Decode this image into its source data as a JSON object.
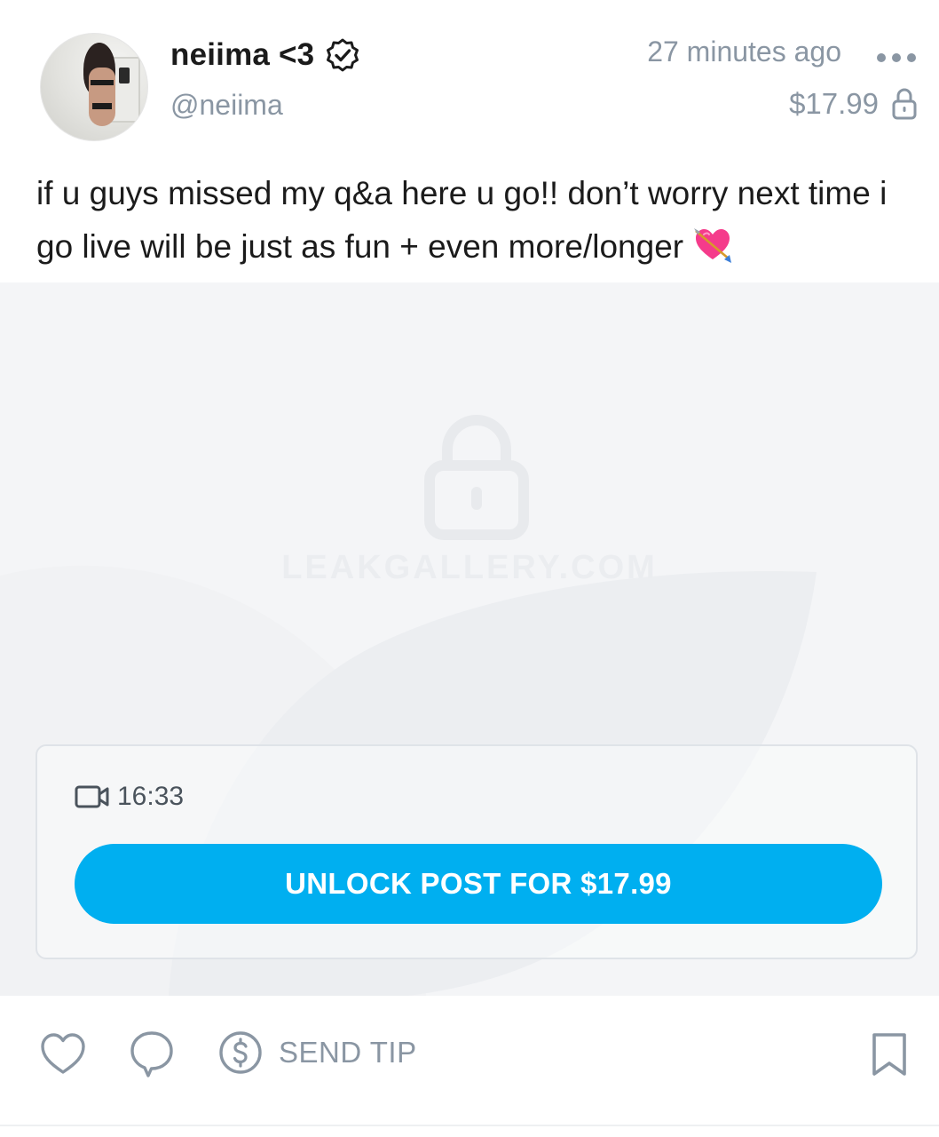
{
  "post": {
    "author": {
      "display_name": "neiima <3",
      "username": "@neiima",
      "verified": true
    },
    "timestamp": "27 minutes ago",
    "price": "$17.99",
    "caption": "if u guys missed my q&a here u go!! don’t worry next time i go live will be just as fun + even more/longer",
    "caption_emoji": "heart-with-arrow-emoji",
    "media": {
      "locked": true,
      "watermark": "LEAKGALLERY.COM",
      "video_duration": "16:33",
      "unlock_label": "UNLOCK POST FOR $17.99"
    }
  },
  "actions": {
    "like_icon": "heart-outline-icon",
    "comment_icon": "comment-bubble-icon",
    "tip_icon": "dollar-circle-icon",
    "tip_label": "SEND TIP",
    "bookmark_icon": "bookmark-icon"
  },
  "colors": {
    "accent": "#00aff0",
    "muted": "#8a96a3",
    "text": "#1b1b1b",
    "media_bg": "#f4f5f7"
  }
}
